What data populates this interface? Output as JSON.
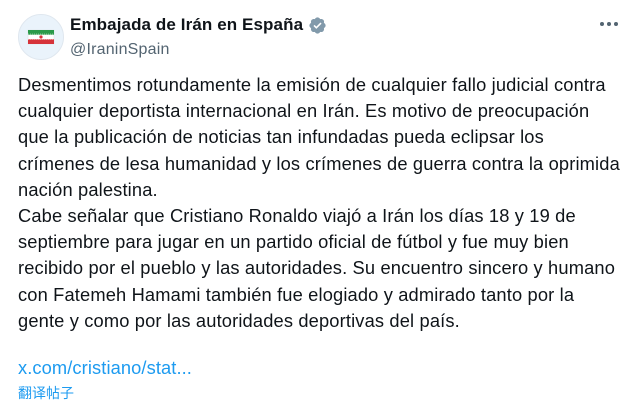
{
  "account": {
    "display_name": "Embajada de Irán en España",
    "handle": "@IraninSpain",
    "verified": true,
    "avatar": "iran-flag-logo"
  },
  "tweet": {
    "paragraphs": [
      "Desmentimos rotundamente la emisión de cualquier fallo judicial contra\ncualquier deportista internacional en Irán. Es motivo de preocupación\nque la publicación de noticias tan infundadas pueda eclipsar los\ncrímenes de lesa humanidad y los crímenes de guerra contra la oprimida\nnación palestina.",
      "Cabe señalar que Cristiano Ronaldo viajó a Irán los días 18 y 19 de\nseptiembre para jugar en un partido oficial de fútbol y fue muy bien\nrecibido por el pueblo y las autoridades. Su encuentro sincero y humano\ncon Fatemeh Hamami también fue elogiado y admirado tanto por la\ngente y como por las autoridades deportivas del país."
    ],
    "link_text": "x.com/cristiano/stat...",
    "translate_label": "翻译帖子"
  },
  "icons": {
    "verified": "verified-badge-icon",
    "more": "more-options-icon"
  },
  "colors": {
    "link": "#1d9bf0",
    "text": "#0f1419",
    "secondary": "#536471",
    "verified": "#829aab"
  }
}
